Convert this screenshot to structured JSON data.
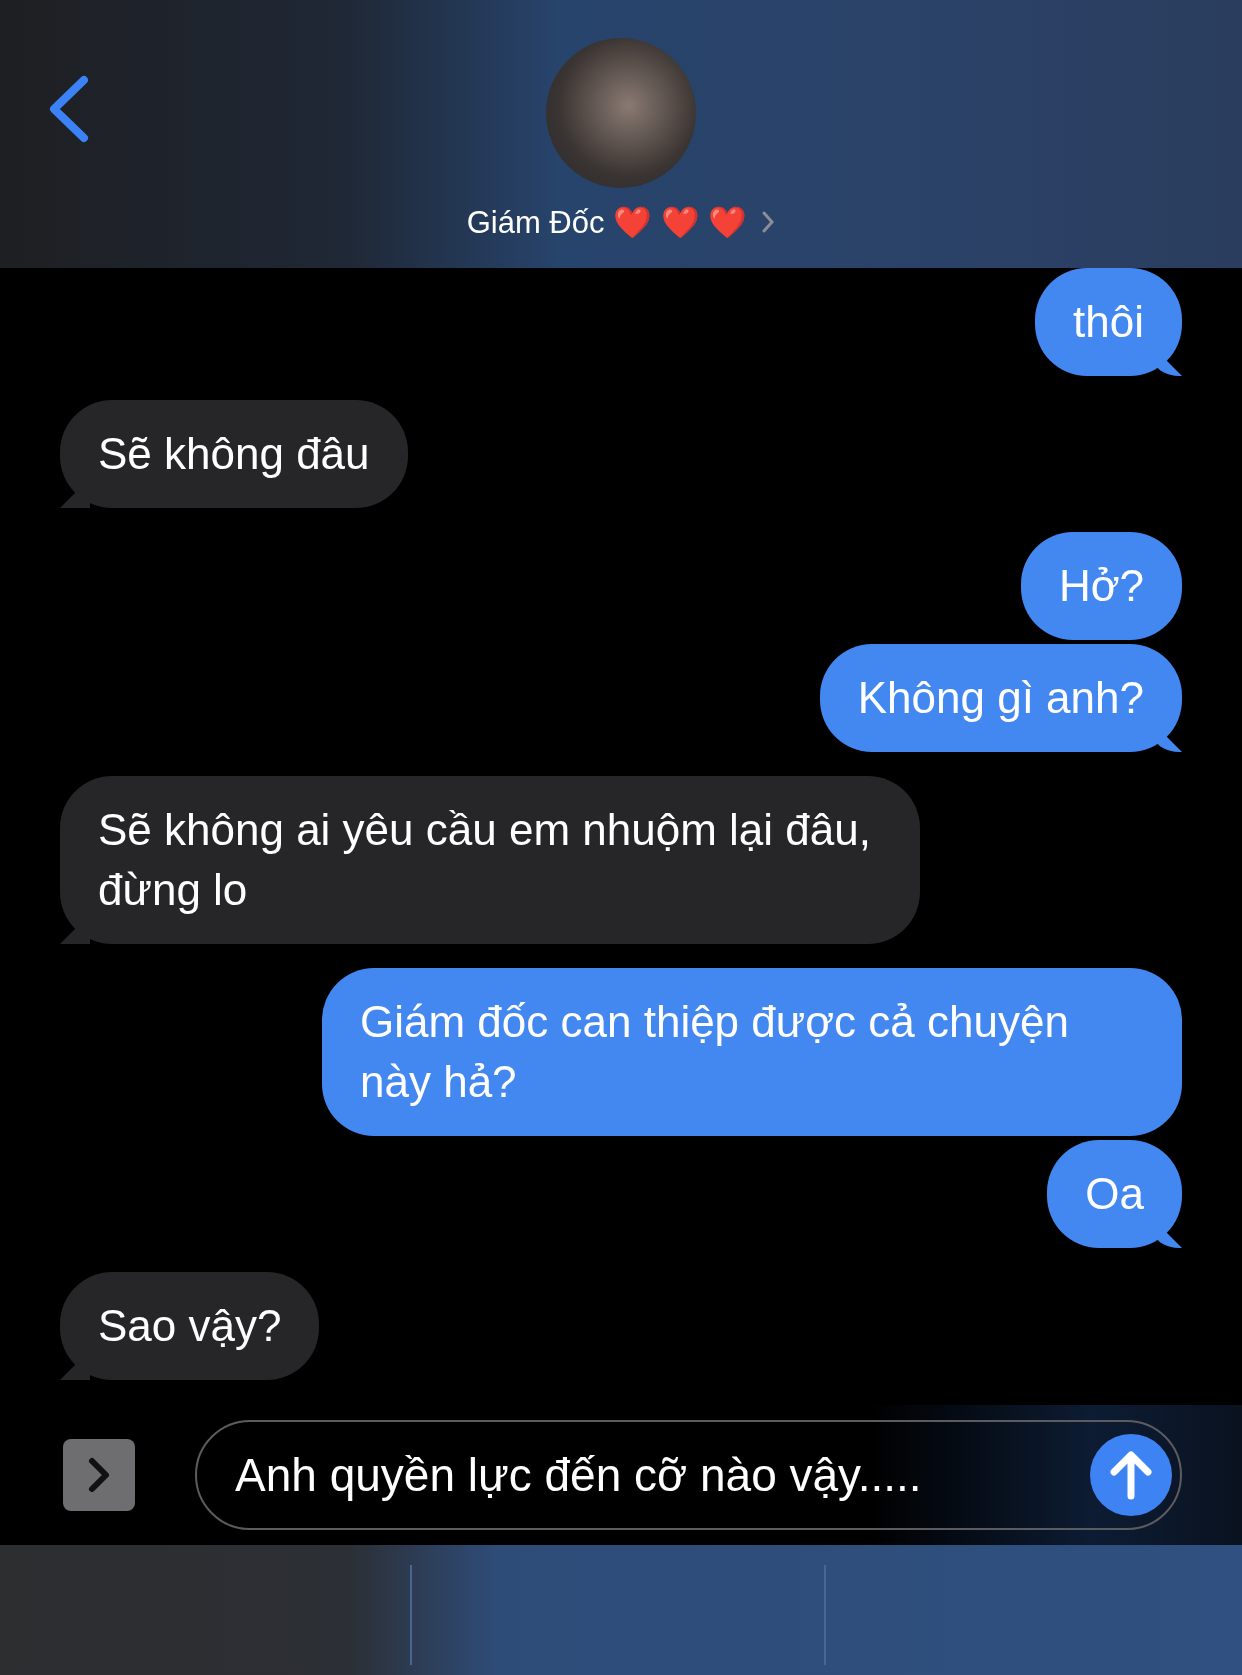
{
  "header": {
    "contact_name": "Giám Đốc ❤️ ❤️ ❤️"
  },
  "messages": [
    {
      "kind": "sent",
      "text": "thôi"
    },
    {
      "kind": "received",
      "text": "Sẽ không đâu"
    },
    {
      "kind": "sent",
      "text": "Hở?"
    },
    {
      "kind": "sent",
      "text": "Không gì anh?"
    },
    {
      "kind": "received",
      "text": "Sẽ không ai yêu cầu em nhuộm lại đâu, đừng lo"
    },
    {
      "kind": "sent",
      "text": "Giám đốc can thiệp được cả chuyện này hả?"
    },
    {
      "kind": "sent",
      "text": "Oa"
    },
    {
      "kind": "received",
      "text": "Sao vậy?"
    }
  ],
  "composer": {
    "value": "Anh quyền lực đến cỡ nào vậy....."
  }
}
